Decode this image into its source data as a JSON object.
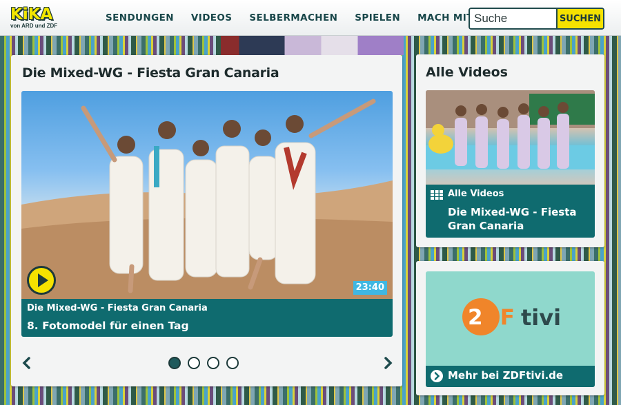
{
  "header": {
    "logo": {
      "word": "KiKA",
      "sub": "von ARD und ZDF"
    },
    "nav": [
      "SENDUNGEN",
      "VIDEOS",
      "SELBERMACHEN",
      "SPIELEN",
      "MACH MIT"
    ],
    "search": {
      "placeholder": "Suche",
      "button_label": "SUCHEN"
    }
  },
  "main": {
    "title": "Die Mixed-WG - Fiesta Gran Canaria",
    "video": {
      "series": "Die Mixed-WG - Fiesta Gran Canaria",
      "episode": "8. Fotomodel für einen Tag",
      "duration": "23:40"
    },
    "carousel": {
      "pages": 4,
      "active_page": 1
    }
  },
  "sidebar": {
    "title": "Alle Videos",
    "item": {
      "tag": "Alle Videos",
      "title": "Die Mixed-WG - Fiesta Gran Canaria"
    }
  },
  "zdf": {
    "logo_text": "ZDFtivi",
    "link_label": "Mehr bei ZDFtivi.de"
  },
  "colors": {
    "brand_yellow": "#f5e200",
    "teal": "#0f6b6f",
    "dark": "#1d3a3a",
    "duration_bg": "#3fb7e2"
  }
}
